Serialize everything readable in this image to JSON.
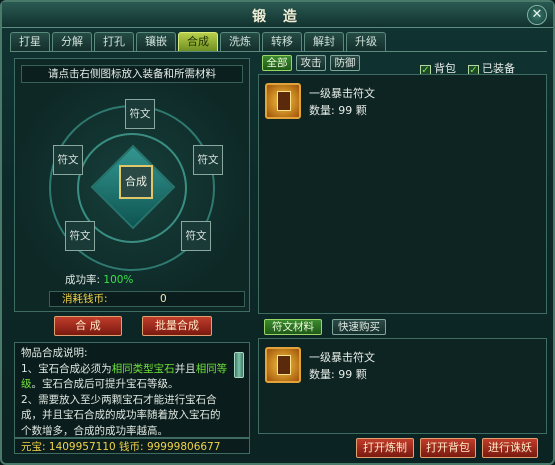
{
  "window": {
    "title": "锻 造",
    "close_label": "✕"
  },
  "tabs": [
    "打星",
    "分解",
    "打孔",
    "镶嵌",
    "合成",
    "洗炼",
    "转移",
    "解封",
    "升级"
  ],
  "left_panel": {
    "hint": "请点击右侧图标放入装备和所需材料",
    "slot_label": "符文",
    "center_label": "合成",
    "success_label": "成功率:",
    "success_value": "100%",
    "cost_label": "消耗钱币:",
    "cost_value": "0"
  },
  "buttons": {
    "synthesize": "合  成",
    "batch_synthesize": "批量合成",
    "open_refine": "打开炼制",
    "open_bag": "打开背包",
    "do_enchant": "进行诛妖"
  },
  "filter": {
    "all": "全部",
    "attack": "攻击",
    "defense": "防御"
  },
  "checks": {
    "bag": "背包",
    "equipped": "已装备"
  },
  "upper_list": [
    {
      "name": "一级暴击符文",
      "qty": "数量: 99 颗"
    }
  ],
  "lower_filter": {
    "rune_material": "符文材料",
    "quick_buy": "快速购买"
  },
  "lower_list": [
    {
      "name": "一级暴击符文",
      "qty": "数量: 99 颗"
    }
  ],
  "description": {
    "heading": "物品合成说明:",
    "line1a": "1、宝石合成必须为",
    "line1b": "相同类型宝石",
    "line1c": "并且",
    "line1d": "相同等级",
    "line1e": "。宝石合成后可提升宝石等级。",
    "line2": "2、需要放入至少两颗宝石才能进行宝石合成，并且宝石合成的成功率随着放入宝石的个数增多，合成的成功率越高。"
  },
  "currency": {
    "yuanbao_label": "元宝:",
    "yuanbao": "1409957110",
    "coin_label": "钱币:",
    "coin": "99999806677"
  },
  "colors": {
    "accent_green": "#38e04a",
    "gold": "#f1d44a",
    "button_red": "#c03c2a"
  }
}
